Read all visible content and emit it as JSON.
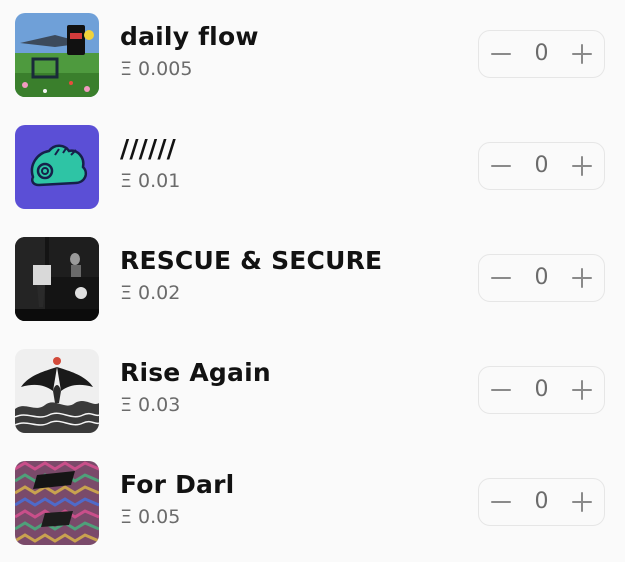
{
  "currency_symbol": "Ξ",
  "items": [
    {
      "title": "daily flow",
      "price": "0.005",
      "quantity": "0",
      "thumbnail": "daily-flow-artwork"
    },
    {
      "title": "//////",
      "price": "0.01",
      "quantity": "0",
      "thumbnail": "blue-creature-artwork"
    },
    {
      "title": "RESCUE & SECURE",
      "price": "0.02",
      "quantity": "0",
      "thumbnail": "rescue-secure-artwork"
    },
    {
      "title": "Rise Again",
      "price": "0.03",
      "quantity": "0",
      "thumbnail": "rise-again-artwork"
    },
    {
      "title": "For Darl",
      "price": "0.05",
      "quantity": "0",
      "thumbnail": "for-darl-artwork"
    }
  ],
  "colors": {
    "title": "#121212",
    "price": "#6b6b6b",
    "stepper_border": "#e6e6e6",
    "thumb_blue": "#5b4fd6"
  }
}
